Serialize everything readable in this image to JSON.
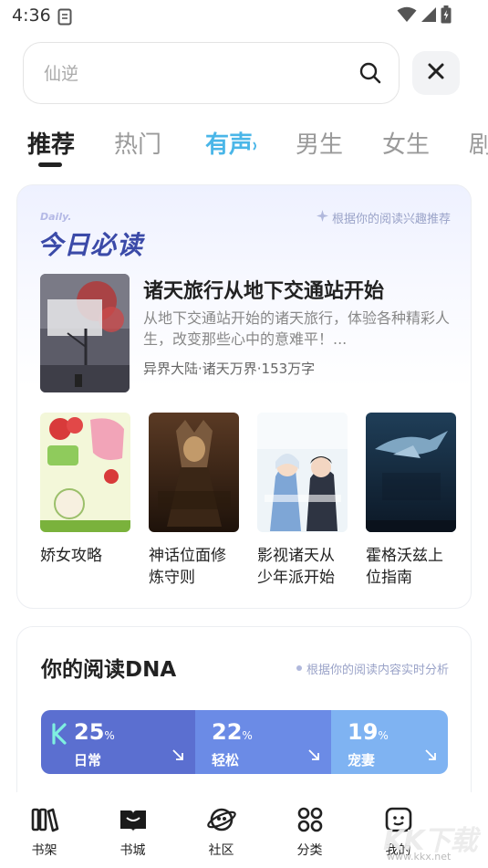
{
  "status_bar": {
    "time": "4:36"
  },
  "search": {
    "placeholder": "仙逆"
  },
  "tabs": [
    {
      "label": "推荐",
      "state": "active"
    },
    {
      "label": "热门",
      "state": "normal"
    },
    {
      "label": "有声",
      "state": "audio"
    },
    {
      "label": "男生",
      "state": "normal"
    },
    {
      "label": "女生",
      "state": "normal"
    },
    {
      "label": "剧",
      "state": "normal"
    }
  ],
  "daily": {
    "label_en": "Daily.",
    "title": "今日必读",
    "hint": "根据你的阅读兴趣推荐",
    "featured": {
      "title": "诸天旅行从地下交通站开始",
      "description": "从地下交通站开始的诸天旅行，体验各种精彩人生，改变那些心中的意难平！...",
      "meta": "异界大陆·诸天万界·153万字"
    },
    "books": [
      {
        "title": "娇女攻略"
      },
      {
        "title": "神话位面修炼守则"
      },
      {
        "title": "影视诸天从少年派开始"
      },
      {
        "title": "霍格沃兹上位指南"
      }
    ]
  },
  "dna": {
    "title": "你的阅读DNA",
    "hint": "根据你的阅读内容实时分析",
    "segments": [
      {
        "percent": "25",
        "unit": "%",
        "label": "日常",
        "share": 0.25,
        "color": "#5b6fd0"
      },
      {
        "percent": "22",
        "unit": "%",
        "label": "轻松",
        "share": 0.22,
        "color": "#6b8be6"
      },
      {
        "percent": "19",
        "unit": "%",
        "label": "宠妻",
        "share": 0.19,
        "color": "#7fb3f2"
      }
    ]
  },
  "bottom_nav": [
    {
      "label": "书架",
      "icon": "bookshelf-icon"
    },
    {
      "label": "书城",
      "icon": "bookstore-icon"
    },
    {
      "label": "社区",
      "icon": "community-icon"
    },
    {
      "label": "分类",
      "icon": "category-icon"
    },
    {
      "label": "我的",
      "icon": "profile-icon"
    }
  ],
  "watermark": {
    "text": "KK下载",
    "url": "www.kkx.net"
  }
}
